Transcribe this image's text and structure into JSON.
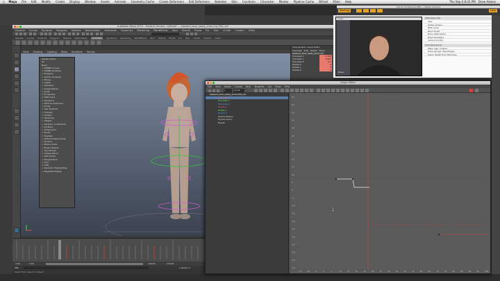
{
  "menubar": {
    "app": "Maya",
    "items": [
      "File",
      "Edit",
      "Modify",
      "Create",
      "Display",
      "Window",
      "Assets",
      "Animate",
      "Geometry Cache",
      "Create Deformers",
      "Edit Deformers",
      "Skeleton",
      "Skin",
      "Constrain",
      "Character",
      "Mentor",
      "Pipeline Cache",
      "Bifrost",
      "XGen",
      "Help"
    ],
    "clock": "Thu Sep 4 8:41 PM",
    "user": "Drew Adams"
  },
  "maya": {
    "window_title": "Autodesk Maya 2015 - Student Version: untitled* --- steward_shot_ready_anim.ma_CSS_ctrl",
    "menu": [
      "General",
      "Curves",
      "Surfaces",
      "Polygons",
      "Subdivs",
      "Deformation",
      "Animation",
      "Dynamics",
      "Rendering",
      "PaintEffects",
      "Toon",
      "Muscle",
      "Fluids",
      "Fur",
      "Hair",
      "nCloth",
      "Custom",
      "XGen"
    ],
    "shelf_tabs": [
      "General",
      "Curves",
      "Surfaces",
      "Polygons",
      "Subdivs",
      "Deformation",
      "Animation",
      "Dynamics",
      "Rendering",
      "PaintEffects",
      "Toon",
      "Muscle",
      "Fluids",
      "Fur",
      "Hair",
      "nCloth",
      "Custom",
      "XGen"
    ],
    "viewport_menu": [
      "View",
      "Shading",
      "Lighting",
      "Show",
      "Renderer",
      "Panels"
    ],
    "show_menu": [
      "Isolate Select",
      "All",
      "None",
      "NURBS Curves",
      "NURBS Surfaces",
      "Polygons",
      "Subdiv Surfaces",
      "Planes",
      "Lights",
      "Cameras",
      "Image Planes",
      "Joints",
      "IK Handles",
      "Deformers",
      "Dynamics",
      "Particle Instancers",
      "Fluids",
      "Hair Systems",
      "Follicles",
      "nCloths",
      "nParticles",
      "nRigids",
      "Dynamic Constraints",
      "Locators",
      "Dimensions",
      "Pivots",
      "Handles",
      "Textures Placements",
      "Strokes",
      "Motion Trails",
      "Plugin Shapes",
      "Clip Ghosts",
      "Grease Pencil",
      "GPU Cache",
      "Manipulators",
      "Grid",
      "HUD",
      "Selection Highlighting",
      "Playblast Display"
    ],
    "channel_box": {
      "header": "Channel Box / Layer Editor",
      "tabs": [
        "Channels",
        "Edit",
        "Object",
        "Show"
      ],
      "object": "steward_shot_ready_anim:ctrl",
      "rows": [
        {
          "name": "Translate X",
          "value": "5.136"
        },
        {
          "name": "Translate Y",
          "value": "3.062"
        },
        {
          "name": "Translate Z",
          "value": "-0.1"
        },
        {
          "name": "Rotate X",
          "value": "0"
        },
        {
          "name": "Rotate Y",
          "value": "0"
        },
        {
          "name": "Rotate Z",
          "value": "0"
        }
      ]
    },
    "range": {
      "start": "1.00",
      "inner_start": "1.00",
      "inner_end": "120.00",
      "end": "120.00"
    },
    "cmd_label": "MEL",
    "result": "// Result: 0",
    "help": "Select Tool: select an object"
  },
  "graph_editor": {
    "title": "Graph Editor",
    "menu": [
      "Edit",
      "View",
      "Select",
      "Curves",
      "Keys",
      "Tangents",
      "List",
      "Show",
      "Help"
    ],
    "stats_left": "1",
    "stats_right": "22.00",
    "outliner_root": "steward_shot_ready_anim:CSS_ctrl",
    "outliner_items": [
      {
        "label": "Translate X",
        "color": "#ff5a5a",
        "selected": true
      },
      {
        "label": "Translate Y",
        "color": "#5aff5a"
      },
      {
        "label": "Translate Z",
        "color": "#5a9aff"
      },
      {
        "label": "Rotate X",
        "color": "#ff5a5a"
      },
      {
        "label": "Rotate Y",
        "color": "#5aff5a"
      },
      {
        "label": "Rotate Z",
        "color": "#5a9aff"
      },
      {
        "label": "Sphere Radius",
        "color": "#dddddd"
      },
      {
        "label": "Square Sized",
        "color": "#dddddd"
      },
      {
        "label": "Breath",
        "color": "#dddddd"
      }
    ],
    "y_ticks": [
      "60",
      "55",
      "50",
      "45",
      "40",
      "35",
      "30",
      "25",
      "20",
      "15",
      "10",
      "5",
      "0",
      "-5",
      "-10",
      "-15",
      "-20",
      "-25",
      "-30",
      "-35",
      "-40",
      "-45",
      "-50"
    ],
    "x_ticks": [
      "-15",
      "-10",
      "-5",
      "0",
      "5",
      "10",
      "15",
      "20",
      "25",
      "30",
      "35",
      "40",
      "45",
      "50",
      "55",
      "60",
      "65",
      "70",
      "75",
      "80",
      "85",
      "90",
      "95",
      "100"
    ]
  },
  "browser": {
    "title": "Link to Conference (EB) — Adobe Connect",
    "tab_meeting": "Meeting",
    "help_btn": "Help"
  },
  "video": {
    "label": "Video",
    "name_tag": "Drew"
  },
  "attendees": {
    "header": "Attendees (16)",
    "list": [
      "Alex",
      "Ashley Jensen",
      "Beth Lowe",
      "Brian Pruitt",
      "Brian Wellingham",
      "Brad Chambers",
      "Cameron Pratt"
    ],
    "chat_header": "Chat (Everyone)",
    "chat": [
      "Major Age: Tinytoll",
      "Drew Varuga: Was Pidgen",
      "Adam: Brazil from Fad-lotus"
    ]
  }
}
